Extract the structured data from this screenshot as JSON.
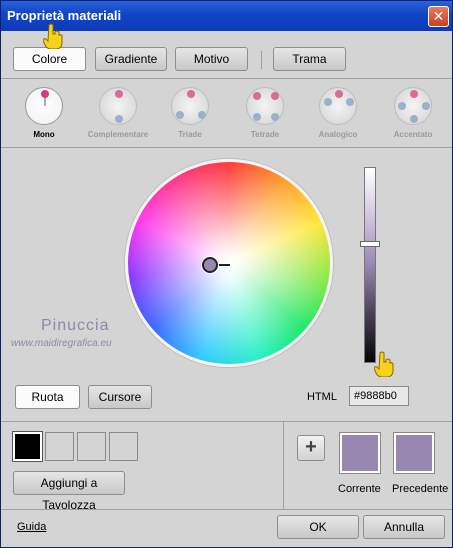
{
  "window": {
    "title": "Proprietà materiali",
    "close_glyph": "✕"
  },
  "tabs": [
    {
      "label": "Colore",
      "active": true
    },
    {
      "label": "Gradiente",
      "active": false
    },
    {
      "label": "Motivo",
      "active": false
    },
    {
      "label": "Trama",
      "active": false
    }
  ],
  "harmonies": [
    {
      "label": "Mono",
      "selected": true
    },
    {
      "label": "Complementare",
      "selected": false
    },
    {
      "label": "Triade",
      "selected": false
    },
    {
      "label": "Tetrade",
      "selected": false
    },
    {
      "label": "Analogico",
      "selected": false
    },
    {
      "label": "Accentato",
      "selected": false
    }
  ],
  "watermark": {
    "line1": "Pinuccia",
    "line2": "www.maidiregrafica.eu"
  },
  "mode_buttons": {
    "wheel": "Ruota",
    "slider": "Cursore"
  },
  "html_field": {
    "label": "HTML",
    "value": "#9888b0"
  },
  "palette": {
    "add_label": "Aggiungi a Tavolozza",
    "plus": "+"
  },
  "swatches": {
    "current_label": "Corrente",
    "previous_label": "Precedente",
    "current_color": "#9888b0",
    "previous_color": "#9888b0"
  },
  "footer": {
    "help": "Guida",
    "ok": "OK",
    "cancel": "Annulla"
  },
  "colors": {
    "accent": "#9888b0",
    "titlebar": "#1246c6"
  }
}
